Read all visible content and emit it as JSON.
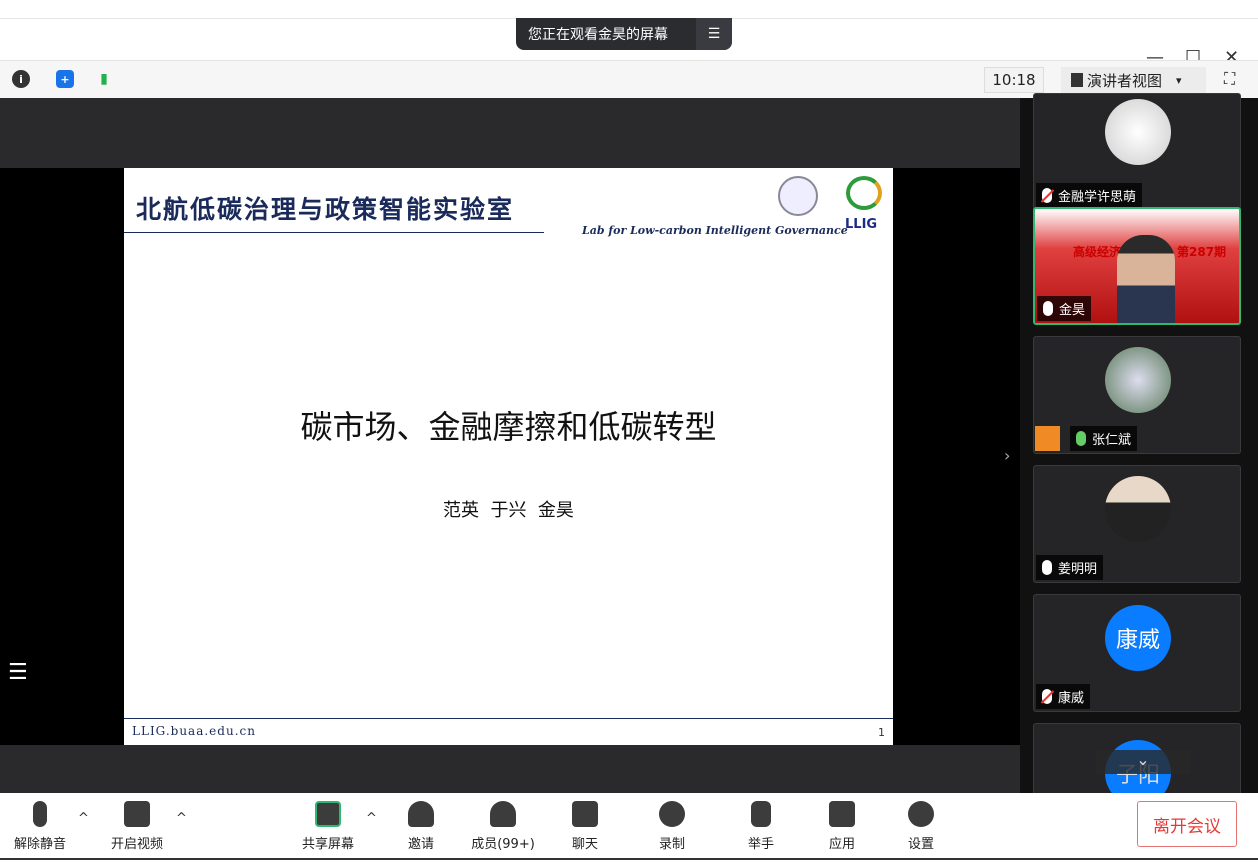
{
  "banner": {
    "text": "您正在观看金昊的屏幕",
    "menu_icon": "menu-icon"
  },
  "window": {
    "minimize": "—",
    "maximize": "☐",
    "close": "✕"
  },
  "toolbar": {
    "clock": "10:18",
    "view_label": "演讲者视图",
    "view_arrow": "▾"
  },
  "slide": {
    "lab_title": "北航低碳治理与政策智能实验室",
    "lab_subtitle": "Lab for Low-carbon Intelligent Governance",
    "logo": "LLIG",
    "title": "碳市场、金融摩擦和低碳转型",
    "authors": "范英  于兴  金昊",
    "footer_url": "LLIG.buaa.edu.cn",
    "page": "1"
  },
  "participants": [
    {
      "name": "金融学许思萌",
      "muted": true
    },
    {
      "name": "金昊",
      "muted": false,
      "active": true,
      "bg_text": "高级经济",
      "bg_text2": "第287期"
    },
    {
      "name": "张仁斌",
      "muted": false
    },
    {
      "name": "姜明明",
      "muted": false
    },
    {
      "name": "康威",
      "muted": true,
      "initials": "康威"
    },
    {
      "name": "子阳",
      "initials": "子阳"
    }
  ],
  "controls": {
    "mute": "解除静音",
    "video": "开启视频",
    "share": "共享屏幕",
    "invite": "邀请",
    "members": "成员(99+)",
    "chat": "聊天",
    "record": "录制",
    "raise": "举手",
    "apps": "应用",
    "settings": "设置",
    "leave": "离开会议"
  },
  "colors": {
    "accent": "#0a7cff",
    "active_border": "#2eb872",
    "leave": "#e53935"
  }
}
